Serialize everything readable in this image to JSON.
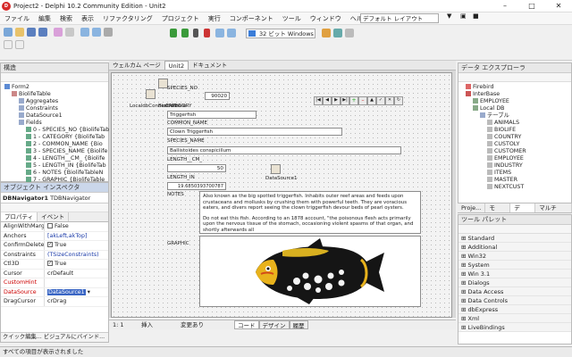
{
  "window": {
    "title": "Project2 - Delphi 10.2 Community Edition - Unit2"
  },
  "menu": [
    "ファイル",
    "編集",
    "検索",
    "表示",
    "リファクタリング",
    "プロジェクト",
    "実行",
    "コンポーネント",
    "ツール",
    "ウィンドウ",
    "ヘルプ"
  ],
  "layout_select": "デフォルト レイアウト",
  "platform_select": "32 ビット Windows",
  "editor_tabs": [
    "ウェルカム ページ",
    "Unit2",
    "ドキュメント"
  ],
  "structure": {
    "title": "構造",
    "items": [
      "Form2",
      "BiolifeTable",
      "Aggregates",
      "Constraints",
      "DataSource1",
      "Fields",
      "0 - SPECIES_NO {BiolifeTab",
      "1 - CATEGORY {BiolifeTab",
      "2 - COMMON_NAME {Bio",
      "3 - SPECIES_NAME {Biolife",
      "4 - LENGTH__CM_ {Biolife",
      "5 - LENGTH_IN {BiolifeTab",
      "6 - NOTES {BiolifeTableN",
      "7 - GRAPHIC {BiolifeTable"
    ]
  },
  "inspector": {
    "title": "オブジェクト インスペクタ",
    "object": "DBNavigator1",
    "object_type": "TDBNavigator",
    "tabs": [
      "プロパティ",
      "イベント"
    ],
    "props": [
      {
        "k": "AlignWithMargins",
        "v": "False",
        "chk": false
      },
      {
        "k": "Anchors",
        "v": "[akLeft,akTop]",
        "style": "blue"
      },
      {
        "k": "ConfirmDelete",
        "v": "True",
        "chk": true
      },
      {
        "k": "Constraints",
        "v": "(TSizeConstraints)",
        "style": "blue"
      },
      {
        "k": "Ctl3D",
        "v": "True",
        "chk": true
      },
      {
        "k": "Cursor",
        "v": "crDefault"
      },
      {
        "k": "CustomHint",
        "v": "",
        "kstyle": "red"
      },
      {
        "k": "DataSource",
        "v": "DataSource1",
        "kstyle": "red",
        "sel": true
      },
      {
        "k": "DragCursor",
        "v": "crDrag"
      }
    ],
    "footer": "クイック編集... ビジュアルにバインド..."
  },
  "form": {
    "labels": {
      "species_no": "SPECIES_NO",
      "category": "CATEGORY",
      "common_name": "COMMON_NAME",
      "species_name": "SPECIES_NAME",
      "length_cm": "LENGTH__CM_",
      "length_in": "LENGTH_IN",
      "notes": "NOTES",
      "graphic": "GRAPHIC",
      "local_conn": "LocaldbConnection",
      "biolife_table": "BiolifeTable",
      "datasource1": "DataSource1"
    },
    "values": {
      "species_no": "90020",
      "category": "Triggerfish",
      "common_name": "Clown Triggerfish",
      "species_name": "Ballistoides conspicillum",
      "length_cm": "50",
      "length_in": "19.6850393700787"
    },
    "notes_p1": "Also known as the big spotted triggerfish.  Inhabits outer reef areas and feeds upon crustaceans and mollusks by crushing them with powerful teeth.  They are voracious eaters, and divers report seeing the clown triggerfish devour beds of pearl oysters.",
    "notes_p2": "Do not eat this fish.  According to an 1878 account, \"the poisonous flesh acts primarily upon the nervous tissue of the stomach, occasioning violent spasms of that organ, and shortly afterwards all"
  },
  "editor_status": {
    "pos": "1: 1",
    "mode": "挿入",
    "modified": "変更あり",
    "tabs": [
      "コード",
      "デザイン",
      "履歴"
    ]
  },
  "data_explorer": {
    "title": "データ エクスプローラ",
    "items": [
      "Firebird",
      "InterBase",
      "EMPLOYEE",
      "Local DB",
      "テーブル",
      "ANIMALS",
      "BIOLIFE",
      "COUNTRY",
      "CUSTOLY",
      "CUSTOMER",
      "EMPLOYEE",
      "INDUSTRY",
      "ITEMS",
      "MASTER",
      "NEXTCUST"
    ]
  },
  "right_tabs": [
    "Proje...",
    "モデ...",
    "デー...",
    "マルチデ..."
  ],
  "palette": {
    "title": "ツール パレット",
    "items": [
      "Standard",
      "Additional",
      "Win32",
      "System",
      "Win 3.1",
      "Dialogs",
      "Data Access",
      "Data Controls",
      "dbExpress",
      "Xml",
      "LiveBindings"
    ]
  },
  "statusbar": "すべての項目が表示されました"
}
